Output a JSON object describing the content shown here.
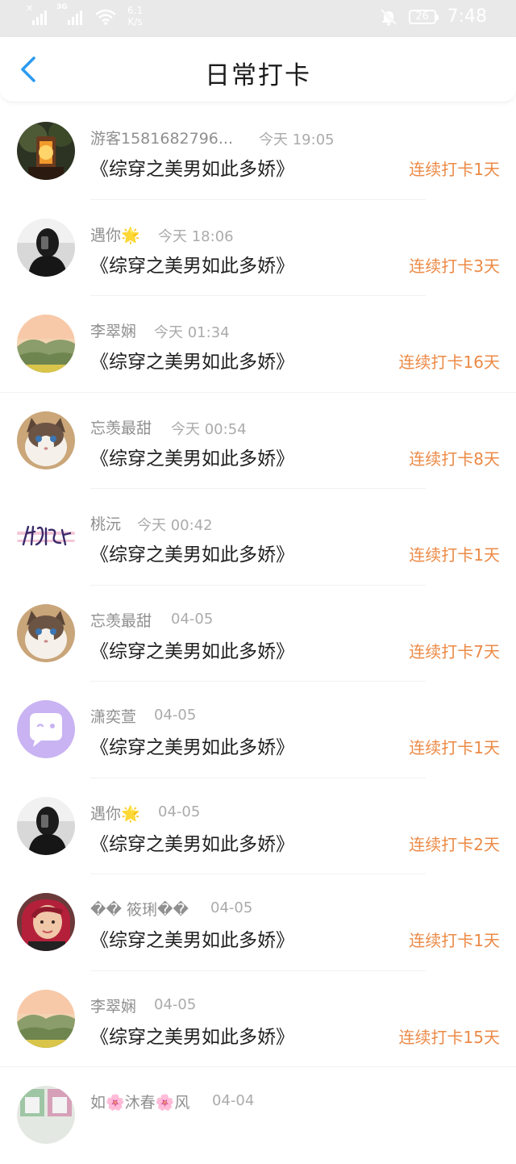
{
  "status_bar": {
    "network": "3G",
    "speed_value": "6.1",
    "speed_unit": "K/s",
    "battery": "26",
    "time": "7:48"
  },
  "header": {
    "title": "日常打卡"
  },
  "entries": [
    {
      "name": "游客1581682796...",
      "date": "今天 19:05",
      "book": "《综穿之美男如此多娇》",
      "streak": "连续打卡1天",
      "avatar": "lantern"
    },
    {
      "name": "遇你🌟",
      "date": "今天 18:06",
      "book": "《综穿之美男如此多娇》",
      "streak": "连续打卡3天",
      "avatar": "selfie"
    },
    {
      "name": "李翠娴",
      "date": "今天 01:34",
      "book": "《综穿之美男如此多娇》",
      "streak": "连续打卡16天",
      "avatar": "landscape"
    },
    {
      "name": "忘羡最甜",
      "date": "今天 00:54",
      "book": "《综穿之美男如此多娇》",
      "streak": "连续打卡8天",
      "avatar": "cat"
    },
    {
      "name": "桃沅",
      "date": "今天 00:42",
      "book": "《综穿之美男如此多娇》",
      "streak": "连续打卡1天",
      "avatar": "calligraphy"
    },
    {
      "name": "忘羡最甜",
      "date": "04-05",
      "book": "《综穿之美男如此多娇》",
      "streak": "连续打卡7天",
      "avatar": "cat"
    },
    {
      "name": "潇奕萱",
      "date": "04-05",
      "book": "《综穿之美男如此多娇》",
      "streak": "连续打卡1天",
      "avatar": "default"
    },
    {
      "name": "遇你🌟",
      "date": "04-05",
      "book": "《综穿之美男如此多娇》",
      "streak": "连续打卡2天",
      "avatar": "selfie"
    },
    {
      "name": "�� 筱琍��",
      "date": "04-05",
      "book": "《综穿之美男如此多娇》",
      "streak": "连续打卡1天",
      "avatar": "portrait"
    },
    {
      "name": "李翠娴",
      "date": "04-05",
      "book": "《综穿之美男如此多娇》",
      "streak": "连续打卡15天",
      "avatar": "landscape"
    },
    {
      "name": "如🌸沐春🌸风",
      "date": "04-04",
      "book": "",
      "streak": "",
      "avatar": "photo"
    }
  ],
  "colors": {
    "streak": "#ec8a46",
    "back_arrow": "#2d9bf0",
    "status_bar_bg": "#e9e9ea"
  }
}
